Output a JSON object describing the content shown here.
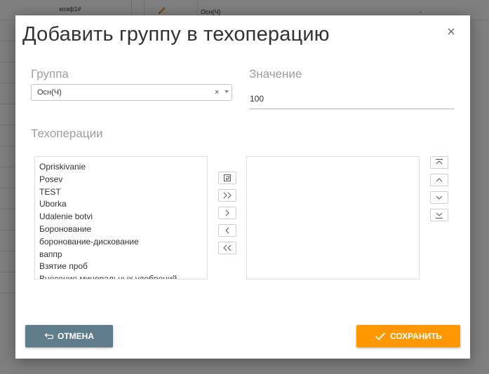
{
  "background": {
    "left_header": "коэф1#",
    "right_row_value": "Осн(Ч)",
    "right_row_dash": "-"
  },
  "dialog": {
    "title": "Добавить группу в техоперацию",
    "close_icon": "close-icon"
  },
  "group": {
    "label": "Группа",
    "selected": "Осн(Ч)",
    "clear_symbol": "×"
  },
  "value": {
    "label": "Значение",
    "current": "100"
  },
  "techops": {
    "label": "Техоперации",
    "available": [
      "Opriskivanie",
      "Posev",
      "TEST",
      "Uborka",
      "Udalenie botvi",
      "Боронование",
      "боронование-дискование",
      "ваппр",
      "Взятие проб",
      "Внесение минеральных удобрений"
    ],
    "selected": []
  },
  "transfer_buttons": [
    {
      "name": "reset-icon"
    },
    {
      "name": "move-all-right-icon",
      "glyph": ">>"
    },
    {
      "name": "move-right-icon",
      "glyph": ">"
    },
    {
      "name": "move-left-icon",
      "glyph": "<"
    },
    {
      "name": "move-all-left-icon",
      "glyph": "<<"
    }
  ],
  "order_buttons": [
    {
      "name": "move-top-icon"
    },
    {
      "name": "move-up-icon"
    },
    {
      "name": "move-down-icon"
    },
    {
      "name": "move-bottom-icon"
    }
  ],
  "footer": {
    "cancel_label": "ОТМЕНА",
    "save_label": "СОХРАНИТЬ"
  },
  "colors": {
    "cancel": "#607d8b",
    "save": "#ff9800"
  }
}
